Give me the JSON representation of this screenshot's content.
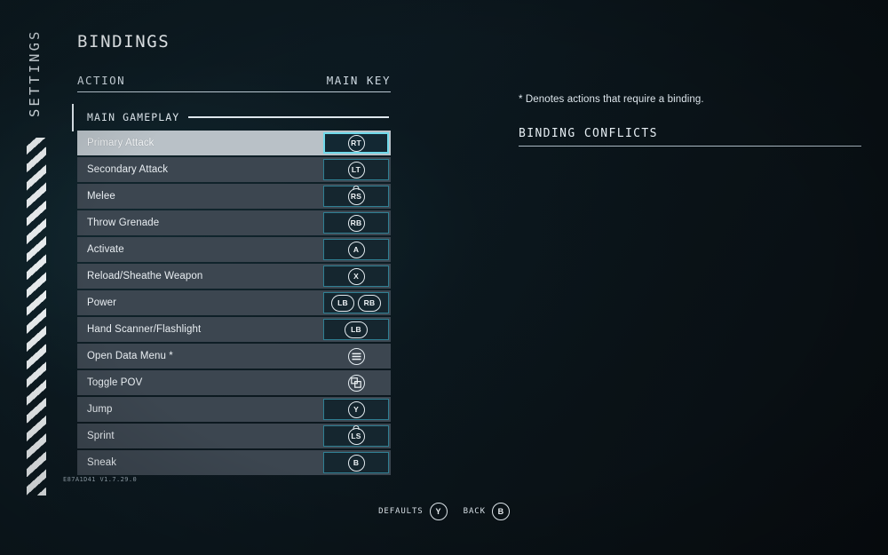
{
  "rail": {
    "label": "SETTINGS",
    "stripes_icon": "diagonal-stripes"
  },
  "header": {
    "title": "BINDINGS",
    "col_action": "ACTION",
    "col_main_key": "MAIN KEY"
  },
  "section": {
    "name": "MAIN GAMEPLAY"
  },
  "bindings": [
    {
      "action": "Primary Attack",
      "selected": true,
      "boxed": true,
      "keys": [
        {
          "glyph": "RT",
          "shape": "round",
          "nub": false
        }
      ]
    },
    {
      "action": "Secondary Attack",
      "selected": false,
      "boxed": true,
      "keys": [
        {
          "glyph": "LT",
          "shape": "round",
          "nub": false
        }
      ]
    },
    {
      "action": "Melee",
      "selected": false,
      "boxed": true,
      "keys": [
        {
          "glyph": "RS",
          "shape": "round",
          "nub": true
        }
      ]
    },
    {
      "action": "Throw Grenade",
      "selected": false,
      "boxed": true,
      "keys": [
        {
          "glyph": "RB",
          "shape": "round",
          "nub": false
        }
      ]
    },
    {
      "action": "Activate",
      "selected": false,
      "boxed": true,
      "keys": [
        {
          "glyph": "A",
          "shape": "round",
          "nub": false
        }
      ]
    },
    {
      "action": "Reload/Sheathe Weapon",
      "selected": false,
      "boxed": true,
      "keys": [
        {
          "glyph": "X",
          "shape": "round",
          "nub": false
        }
      ]
    },
    {
      "action": "Power",
      "selected": false,
      "boxed": true,
      "keys": [
        {
          "glyph": "LB",
          "shape": "wide",
          "nub": false
        },
        {
          "glyph": "RB",
          "shape": "wide",
          "nub": false
        }
      ]
    },
    {
      "action": "Hand Scanner/Flashlight",
      "selected": false,
      "boxed": true,
      "keys": [
        {
          "glyph": "LB",
          "shape": "wide",
          "nub": false
        }
      ]
    },
    {
      "action": "Open Data Menu *",
      "selected": false,
      "boxed": false,
      "keys": [
        {
          "glyph": "menu-icon",
          "shape": "icon",
          "nub": false
        }
      ]
    },
    {
      "action": "Toggle POV",
      "selected": false,
      "boxed": false,
      "keys": [
        {
          "glyph": "window-icon",
          "shape": "icon",
          "nub": false
        }
      ]
    },
    {
      "action": "Jump",
      "selected": false,
      "boxed": true,
      "keys": [
        {
          "glyph": "Y",
          "shape": "round",
          "nub": false
        }
      ]
    },
    {
      "action": "Sprint",
      "selected": false,
      "boxed": true,
      "keys": [
        {
          "glyph": "LS",
          "shape": "round",
          "nub": true
        }
      ]
    },
    {
      "action": "Sneak",
      "selected": false,
      "boxed": true,
      "keys": [
        {
          "glyph": "B",
          "shape": "round",
          "nub": false
        }
      ]
    }
  ],
  "build_code": "E87A1D41 V1.7.29.0",
  "right_panel": {
    "note": "* Denotes actions that require a binding.",
    "conflicts_title": "BINDING CONFLICTS",
    "conflicts": []
  },
  "footer": {
    "buttons": [
      {
        "label": "DEFAULTS",
        "glyph": "Y"
      },
      {
        "label": "BACK",
        "glyph": "B"
      }
    ]
  },
  "colors": {
    "accent_cyan": "#6fd9ea",
    "key_border": "#2f7f93",
    "row_bg": "#3c4650",
    "row_selected_bg": "#b9c1c7",
    "text": "#e6edf2",
    "background": "#0a1014"
  }
}
